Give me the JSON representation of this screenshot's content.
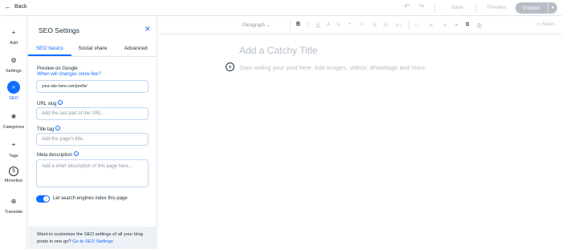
{
  "topbar": {
    "back_label": "Back",
    "save_label": "Save",
    "preview_label": "Preview",
    "publish_label": "Publish"
  },
  "rail": [
    {
      "label": "Add",
      "icon": "plus-icon",
      "glyph": "+"
    },
    {
      "label": "Settings",
      "icon": "gear-icon",
      "glyph": "⚙"
    },
    {
      "label": "SEO",
      "icon": "search-icon",
      "glyph": "⌕",
      "active": true
    },
    {
      "label": "Categories",
      "icon": "categories-icon",
      "glyph": "❀"
    },
    {
      "label": "Tags",
      "icon": "tag-icon",
      "glyph": "⌖"
    },
    {
      "label": "Monetize",
      "icon": "dollar-icon",
      "glyph": "$"
    },
    {
      "label": "Translate",
      "icon": "globe-icon",
      "glyph": "⊕"
    }
  ],
  "panel": {
    "title": "SEO Settings",
    "tabs": [
      "SEO basics",
      "Social share",
      "Advanced"
    ],
    "active_tab": "SEO basics",
    "preview_label": "Preview on Google",
    "preview_link": "When will changes show live?",
    "url_value": "your-site-here.com/prefix/",
    "slug_label": "URL slug",
    "slug_placeholder": "Add the last part of the URL...",
    "title_tag_label": "Title tag",
    "title_tag_placeholder": "Add the page's title...",
    "meta_label": "Meta description",
    "meta_placeholder": "Add a short description of this page here...",
    "index_toggle_label": "Let search engines index this page",
    "index_toggle_on": true,
    "footer_text": "Want to customize the SEO settings of all your blog posts in one go?",
    "footer_link": "Go to SEO Settings"
  },
  "toolbar": {
    "paragraph_label": "Paragraph",
    "notes_label": "Notes"
  },
  "editor": {
    "title_placeholder": "Add a Catchy Title",
    "body_placeholder": "Start writing your post here. Add images, videos, #hashtags and more."
  },
  "colors": {
    "accent": "#116dff",
    "muted": "#b6bdc6",
    "text": "#20303c"
  }
}
